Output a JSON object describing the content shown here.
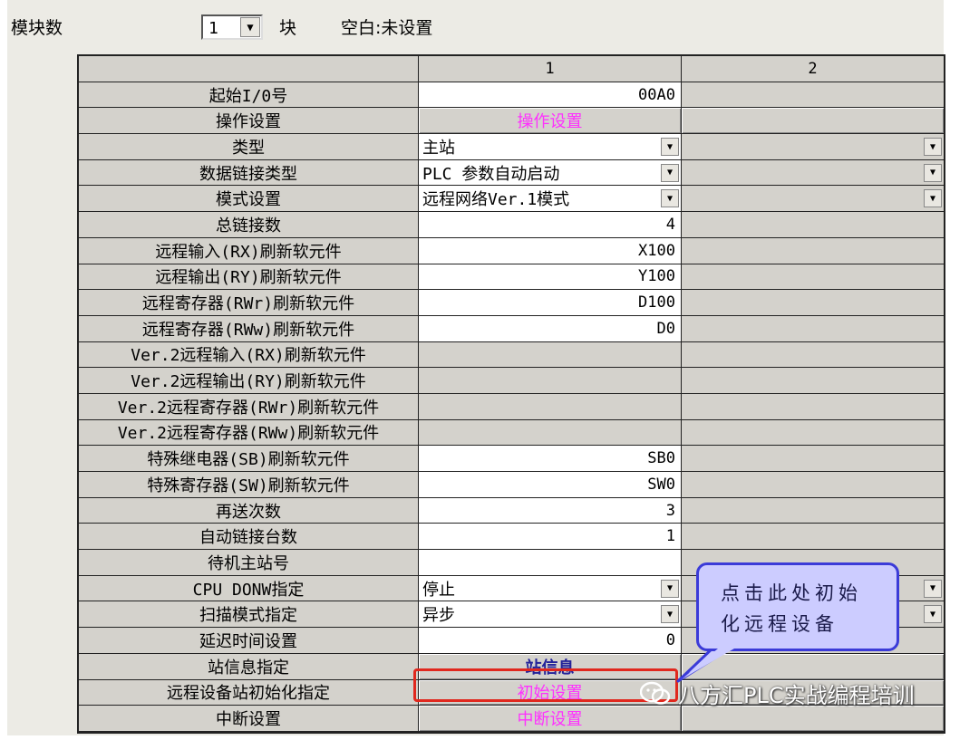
{
  "top": {
    "module_count_label": "模块数",
    "module_count_value": "1",
    "unit": "块",
    "blank_status": "空白:未设置"
  },
  "grid": {
    "header": [
      "",
      "1",
      "2"
    ],
    "rows": [
      {
        "label": "起始I/0号",
        "v1": "00A0"
      },
      {
        "label": "操作设置",
        "v1": "操作设置"
      },
      {
        "label": "类型",
        "v1": "主站"
      },
      {
        "label": "数据链接类型",
        "v1": "PLC 参数自动启动"
      },
      {
        "label": "模式设置",
        "v1": "远程网络Ver.1模式"
      },
      {
        "label": "总链接数",
        "v1": "4"
      },
      {
        "label": "远程输入(RX)刷新软元件",
        "v1": "X100"
      },
      {
        "label": "远程输出(RY)刷新软元件",
        "v1": "Y100"
      },
      {
        "label": "远程寄存器(RWr)刷新软元件",
        "v1": "D100"
      },
      {
        "label": "远程寄存器(RWw)刷新软元件",
        "v1": "D0"
      },
      {
        "label": "Ver.2远程输入(RX)刷新软元件",
        "v1": ""
      },
      {
        "label": "Ver.2远程输出(RY)刷新软元件",
        "v1": ""
      },
      {
        "label": "Ver.2远程寄存器(RWr)刷新软元件",
        "v1": ""
      },
      {
        "label": "Ver.2远程寄存器(RWw)刷新软元件",
        "v1": ""
      },
      {
        "label": "特殊继电器(SB)刷新软元件",
        "v1": "SB0"
      },
      {
        "label": "特殊寄存器(SW)刷新软元件",
        "v1": "SW0"
      },
      {
        "label": "再送次数",
        "v1": "3"
      },
      {
        "label": "自动链接台数",
        "v1": "1"
      },
      {
        "label": "待机主站号",
        "v1": ""
      },
      {
        "label": "CPU DONW指定",
        "v1": "停止"
      },
      {
        "label": "扫描模式指定",
        "v1": "异步"
      },
      {
        "label": "延迟时间设置",
        "v1": "0"
      },
      {
        "label": "站信息指定",
        "v1": "站信息"
      },
      {
        "label": "远程设备站初始化指定",
        "v1": "初始设置"
      },
      {
        "label": "中断设置",
        "v1": "中断设置"
      }
    ]
  },
  "callout": {
    "text": "点击此处初始化远程设备"
  },
  "watermark": {
    "text": "八方汇PLC实战编程培训"
  },
  "colors": {
    "button_text_magenta": "#ff30ff",
    "button_text_navy": "#23239a",
    "highlight": "#e0281e",
    "callout_fill": "#ccccff",
    "callout_border": "#3b3bd8"
  }
}
